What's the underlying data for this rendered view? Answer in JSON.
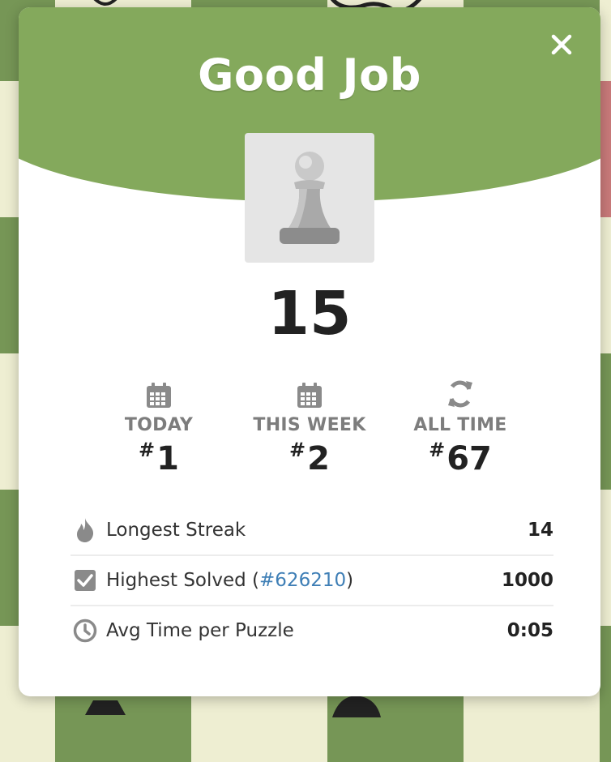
{
  "modal": {
    "title": "Good Job",
    "close_icon": "close-icon",
    "piece_icon": "pawn-icon",
    "score": "15"
  },
  "ranks": [
    {
      "icon": "calendar-icon",
      "label": "TODAY",
      "hash": "#",
      "value": "1"
    },
    {
      "icon": "calendar-icon",
      "label": "THIS WEEK",
      "hash": "#",
      "value": "2"
    },
    {
      "icon": "refresh-icon",
      "label": "ALL TIME",
      "hash": "#",
      "value": "67"
    }
  ],
  "stats": {
    "longest_streak": {
      "icon": "flame-icon",
      "label": "Longest Streak",
      "value": "14"
    },
    "highest_solved": {
      "icon": "checkbox-icon",
      "label_before": "Highest Solved (",
      "link": "#626210",
      "label_after": ")",
      "value": "1000"
    },
    "avg_time": {
      "icon": "clock-icon",
      "label": "Avg Time per Puzzle",
      "value": "0:05"
    }
  },
  "colors": {
    "header_green": "#84a95c",
    "board_dark": "#769656",
    "board_light": "#eeeed2",
    "link_blue": "#3f7fb6"
  }
}
